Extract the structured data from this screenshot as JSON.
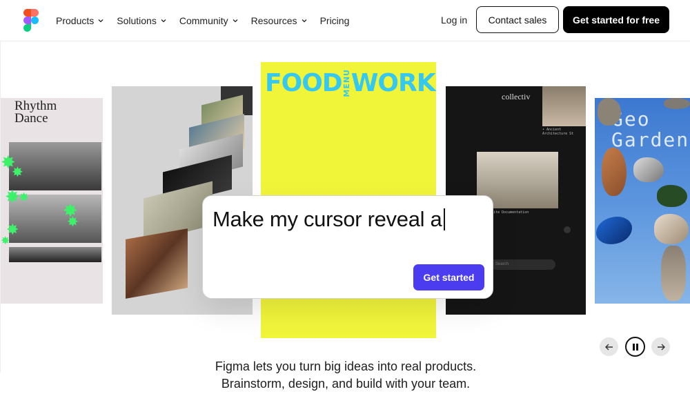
{
  "nav": {
    "items": [
      {
        "label": "Products"
      },
      {
        "label": "Solutions"
      },
      {
        "label": "Community"
      },
      {
        "label": "Resources"
      },
      {
        "label": "Pricing"
      }
    ],
    "login_label": "Log in",
    "contact_label": "Contact sales",
    "cta_label": "Get started for free"
  },
  "hero": {
    "cards": {
      "rhythm_title": "Rhythm Dance",
      "food_title_left": "FOOD",
      "food_title_mid": "MENU",
      "food_title_right": "WORKS",
      "collectiv_title": "collectiv",
      "collectiv_caption_top": "• Ancient Architecture St",
      "collectiv_caption_mid": "ogical Site Documentation",
      "collectiv_search": "Search",
      "geo_title_line1": "Geo",
      "geo_title_line2": "Garden"
    },
    "prompt": {
      "text": "Make my cursor reveal a",
      "button_label": "Get started"
    },
    "carousel": {
      "prev_icon": "arrow-left-icon",
      "pause_icon": "pause-icon",
      "next_icon": "arrow-right-icon"
    },
    "tagline_line1": "Figma lets you turn big ideas into real products.",
    "tagline_line2": "Brainstorm, design, and build with your team."
  },
  "colors": {
    "cta_bg": "#000000",
    "prompt_button": "#4b3cf0",
    "food_card": "#f1f53a",
    "food_title": "#35c8f0",
    "star_green": "#3ef16a"
  }
}
